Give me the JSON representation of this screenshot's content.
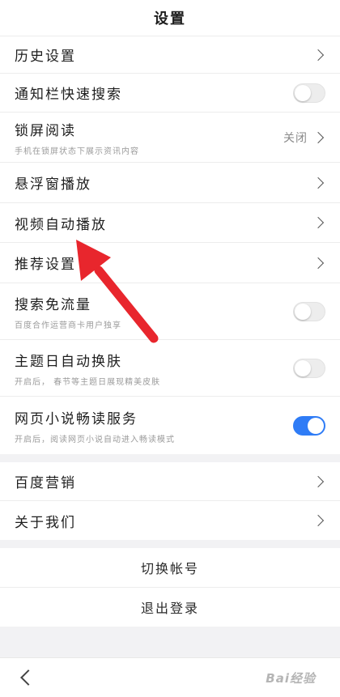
{
  "header": {
    "title": "设置"
  },
  "settings": {
    "history": {
      "title": "历史设置"
    },
    "notification_search": {
      "title": "通知栏快速搜索",
      "toggle": "off"
    },
    "lockscreen": {
      "title": "锁屏阅读",
      "subtitle": "手机在锁屏状态下展示资讯内容",
      "value": "关闭"
    },
    "floating_window": {
      "title": "悬浮窗播放"
    },
    "video_autoplay": {
      "title": "视频自动播放"
    },
    "recommend": {
      "title": "推荐设置"
    },
    "search_free_data": {
      "title": "搜索免流量",
      "subtitle": "百度合作运营商卡用户独享",
      "toggle": "off"
    },
    "theme_skin": {
      "title": "主题日自动换肤",
      "subtitle": "开启后， 春节等主题日展现精美皮肤",
      "toggle": "off"
    },
    "novel_reader": {
      "title": "网页小说畅读服务",
      "subtitle": "开启后，阅读网页小说自动进入畅读模式",
      "toggle": "on"
    }
  },
  "more": {
    "marketing": {
      "title": "百度营销"
    },
    "about": {
      "title": "关于我们"
    }
  },
  "account": {
    "switch": "切换帐号",
    "logout": "退出登录"
  },
  "bottom": {
    "watermark": "Bai经验"
  },
  "colors": {
    "accent": "#2f7cf6",
    "annotation_arrow": "#e8262d"
  },
  "annotation": {
    "type": "red-arrow",
    "points_to": "视频自动播放"
  }
}
